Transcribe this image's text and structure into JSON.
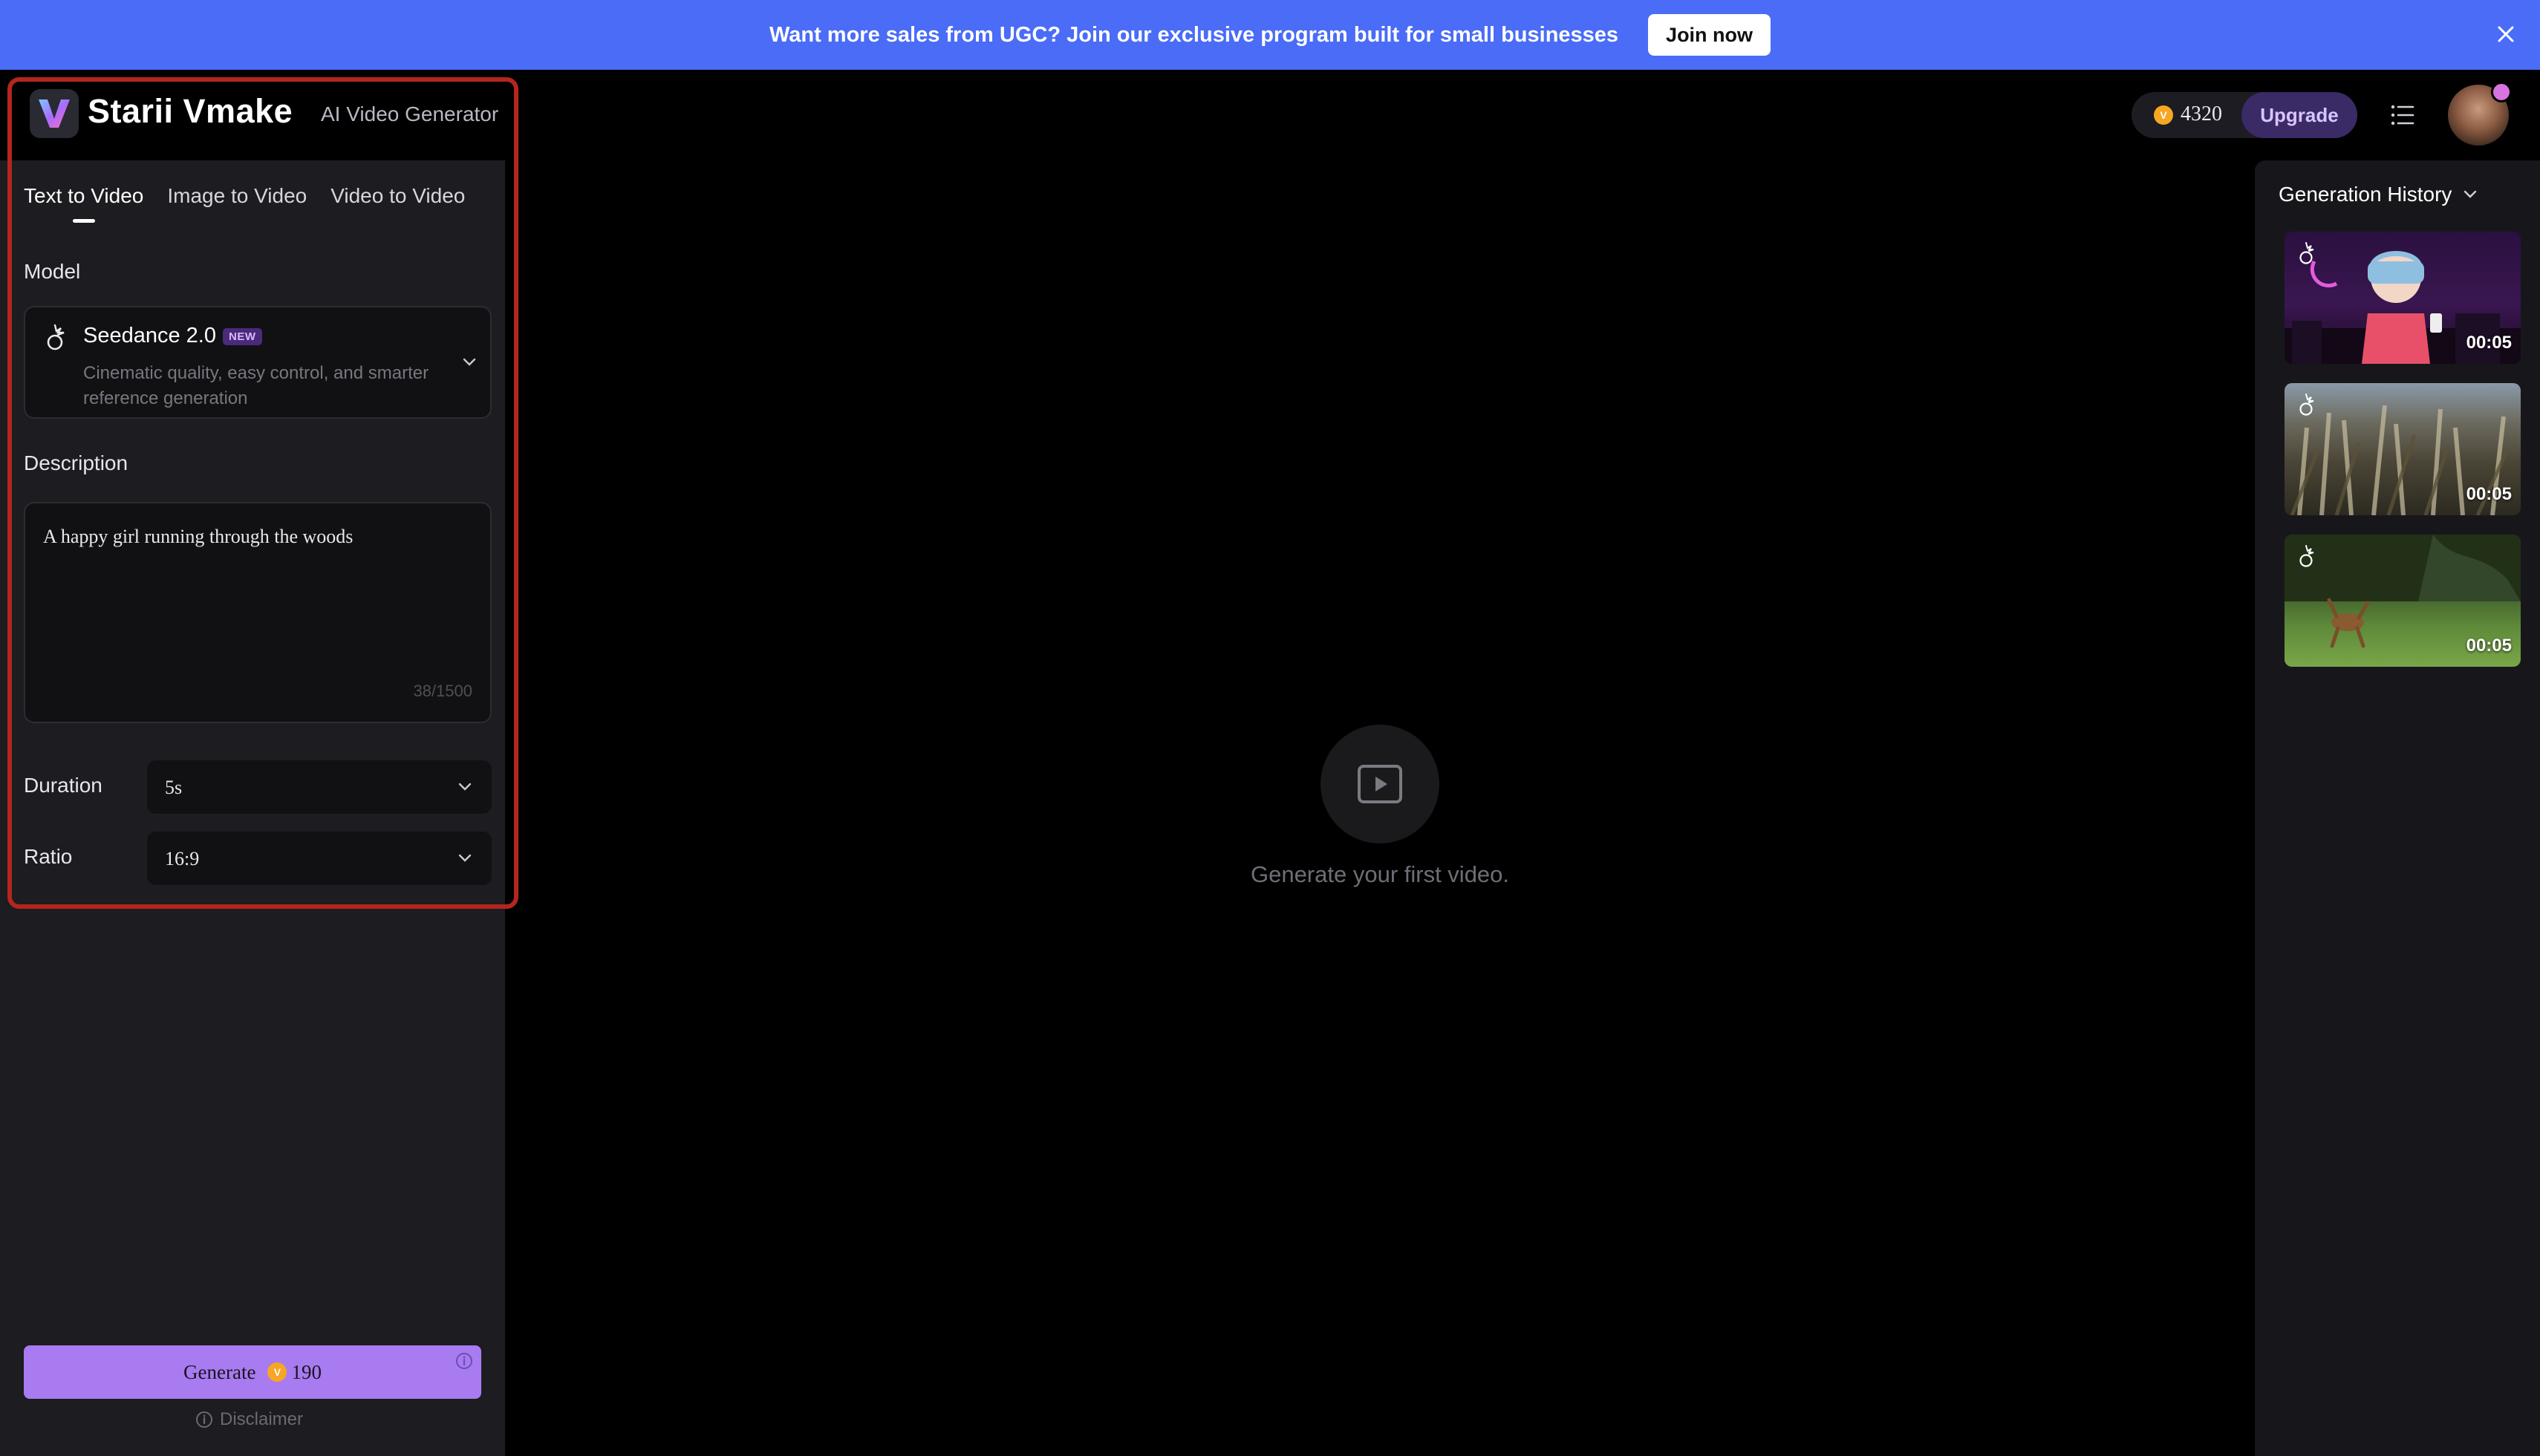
{
  "banner": {
    "text": "Want more sales from UGC? Join our exclusive program built for small businesses",
    "cta_label": "Join now"
  },
  "app": {
    "brand": "Starii Vmake",
    "tagline": "AI Video Generator"
  },
  "tabs": [
    {
      "label": "Text to Video",
      "active": true
    },
    {
      "label": "Image to Video",
      "active": false
    },
    {
      "label": "Video to Video",
      "active": false
    }
  ],
  "model": {
    "section_label": "Model",
    "name": "Seedance 2.0",
    "badge": "NEW",
    "description": "Cinematic quality, easy control, and smarter reference generation"
  },
  "description": {
    "section_label": "Description",
    "value": "A happy girl running through the woods",
    "counter": "38/1500"
  },
  "duration": {
    "label": "Duration",
    "value": "5s"
  },
  "ratio": {
    "label": "Ratio",
    "value": "16:9"
  },
  "generate": {
    "label": "Generate",
    "cost": "190",
    "disclaimer": "Disclaimer"
  },
  "account": {
    "credits": "4320",
    "upgrade_label": "Upgrade"
  },
  "empty_state": {
    "text": "Generate your first video."
  },
  "history": {
    "title": "Generation History",
    "items": [
      {
        "duration": "00:05"
      },
      {
        "duration": "00:05"
      },
      {
        "duration": "00:05"
      }
    ]
  },
  "colors": {
    "banner": "#4a6cf7",
    "accent": "#a87bf0",
    "highlight": "#b3261e",
    "coin": "#f6a623"
  }
}
